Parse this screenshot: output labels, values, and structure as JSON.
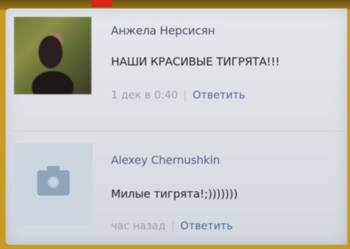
{
  "comments": [
    {
      "author": "Анжела Нерсисян",
      "text": "НАШИ КРАСИВЫЕ ТИГРЯТА!!!",
      "time": "1 дек в 0:40",
      "separator": "|",
      "reply_label": "Ответить",
      "avatar": "photo"
    },
    {
      "author": "Alexey Chernushkin",
      "text": "Милые тигрята!;)))))))",
      "time": "час назад",
      "separator": "|",
      "reply_label": "Ответить",
      "avatar": "camera-icon"
    }
  ],
  "colors": {
    "author_link": "#3f4e66",
    "reply_link": "#4a6b99",
    "meta_gray": "#99a1ab",
    "background": "#e2e5ea"
  }
}
